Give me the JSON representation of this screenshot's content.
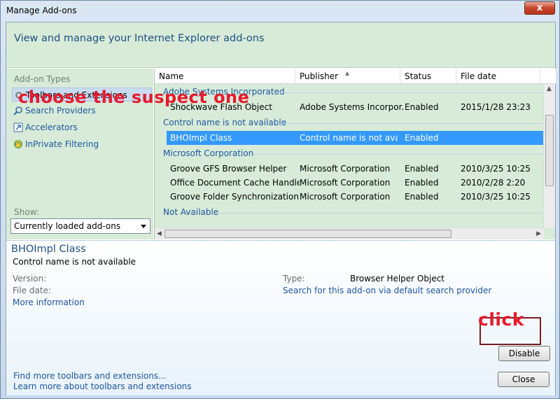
{
  "window": {
    "title": "Manage Add-ons",
    "close_glyph": "x"
  },
  "header": {
    "text": "View and manage your Internet Explorer add-ons"
  },
  "left": {
    "section_label": "Add-on Types",
    "types": [
      {
        "label": "Toolbars and Extensions",
        "icon": "gear-icon"
      },
      {
        "label": "Search Providers",
        "icon": "search-icon"
      },
      {
        "label": "Accelerators",
        "icon": "accelerator-icon"
      },
      {
        "label": "InPrivate Filtering",
        "icon": "inprivate-icon"
      }
    ],
    "show_label": "Show:",
    "show_value": "Currently loaded add-ons"
  },
  "list": {
    "columns": [
      "Name",
      "Publisher",
      "Status",
      "File date"
    ],
    "groups": [
      {
        "name": "Adobe Systems Incorporated",
        "rows": [
          {
            "name": "Shockwave Flash Object",
            "publisher": "Adobe Systems Incorpor...",
            "status": "Enabled",
            "date": "2015/1/28 23:23"
          }
        ]
      },
      {
        "name": "Control name is not available",
        "rows": [
          {
            "name": "BHOImpl Class",
            "publisher": "Control name is not avai...",
            "status": "Enabled",
            "date": ""
          }
        ]
      },
      {
        "name": "Microsoft Corporation",
        "rows": [
          {
            "name": "Groove GFS Browser Helper",
            "publisher": "Microsoft Corporation",
            "status": "Enabled",
            "date": "2010/3/25 10:25"
          },
          {
            "name": "Office Document Cache Handler",
            "publisher": "Microsoft Corporation",
            "status": "Enabled",
            "date": "2010/2/28 2:20"
          },
          {
            "name": "Groove Folder Synchronization",
            "publisher": "Microsoft Corporation",
            "status": "Enabled",
            "date": "2010/3/25 10:25"
          }
        ]
      },
      {
        "name": "Not Available",
        "rows": []
      }
    ]
  },
  "details": {
    "title": "BHOImpl Class",
    "subtitle": "Control name is not available",
    "version_label": "Version:",
    "file_date_label": "File date:",
    "more_info": "More information",
    "type_label": "Type:",
    "type_value": "Browser Helper Object",
    "search_link": "Search for this add-on via default search provider"
  },
  "footer": {
    "find_link": "Find more toolbars and extensions...",
    "learn_link": "Learn more about toolbars and extensions",
    "disable_button": "Disable",
    "close_button": "Close"
  },
  "annotations": {
    "choose": "choose the suspect one",
    "click": "click",
    "color": "#e8192c"
  }
}
